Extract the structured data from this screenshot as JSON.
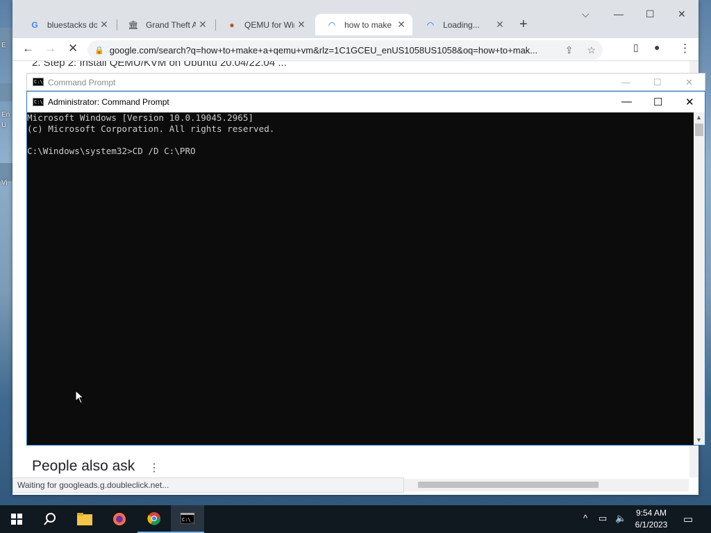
{
  "browser": {
    "tabs": [
      {
        "title": "bluestacks do",
        "icon": "google-g-icon",
        "active": false
      },
      {
        "title": "Grand Theft A",
        "icon": "museum-icon",
        "active": false
      },
      {
        "title": "QEMU for Win",
        "icon": "qemu-icon",
        "active": false
      },
      {
        "title": "how to make e",
        "icon": "loading-spinner-icon",
        "active": true
      },
      {
        "title": "Loading...",
        "icon": "loading-spinner-icon",
        "active": false
      }
    ],
    "url": "google.com/search?q=how+to+make+a+qemu+vm&rlz=1C1GCEU_enUS1058US1058&oq=how+to+mak...",
    "page_step_text": "2. Step 2: Install QEMU/KVM on Ubuntu 20.04/22.04 ...",
    "people_also_ask": "People also ask",
    "status_text": "Waiting for googleads.g.doubleclick.net..."
  },
  "cmd_back": {
    "title": "Command Prompt"
  },
  "cmd": {
    "title": "Administrator:  Command Prompt",
    "lines": [
      "Microsoft Windows [Version 10.0.19045.2965]",
      "(c) Microsoft Corporation. All rights reserved.",
      "",
      "C:\\Windows\\system32>CD /D C:\\PRO"
    ]
  },
  "taskbar": {
    "time": "9:54 AM",
    "date": "6/1/2023"
  },
  "desktop_labels": [
    "E",
    "En",
    "U",
    "Vi"
  ],
  "colors": {
    "accent": "#1f78d1",
    "taskbar": "#101820",
    "console_bg": "#0c0c0c",
    "console_fg": "#cccccc"
  }
}
